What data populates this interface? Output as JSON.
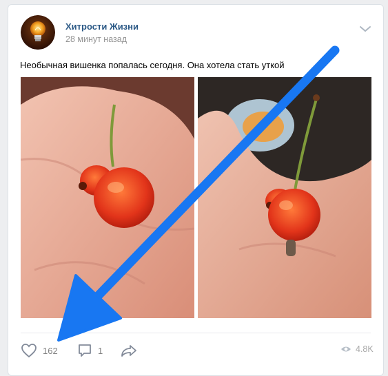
{
  "post": {
    "author": "Хитрости Жизни",
    "time": "28 минут назад",
    "text": "Необычная вишенка попалась сегодня. Она хотела стать уткой",
    "likes": "162",
    "comments": "1",
    "views": "4.8K"
  },
  "icons": {
    "avatar": "lightbulb-icon",
    "menu": "chevron-down-icon",
    "like": "heart-icon",
    "comment": "comment-icon",
    "share": "share-icon",
    "views": "eye-icon"
  },
  "colors": {
    "author": "#2a5885",
    "arrow": "#1877f2",
    "background": "#edeef0"
  }
}
